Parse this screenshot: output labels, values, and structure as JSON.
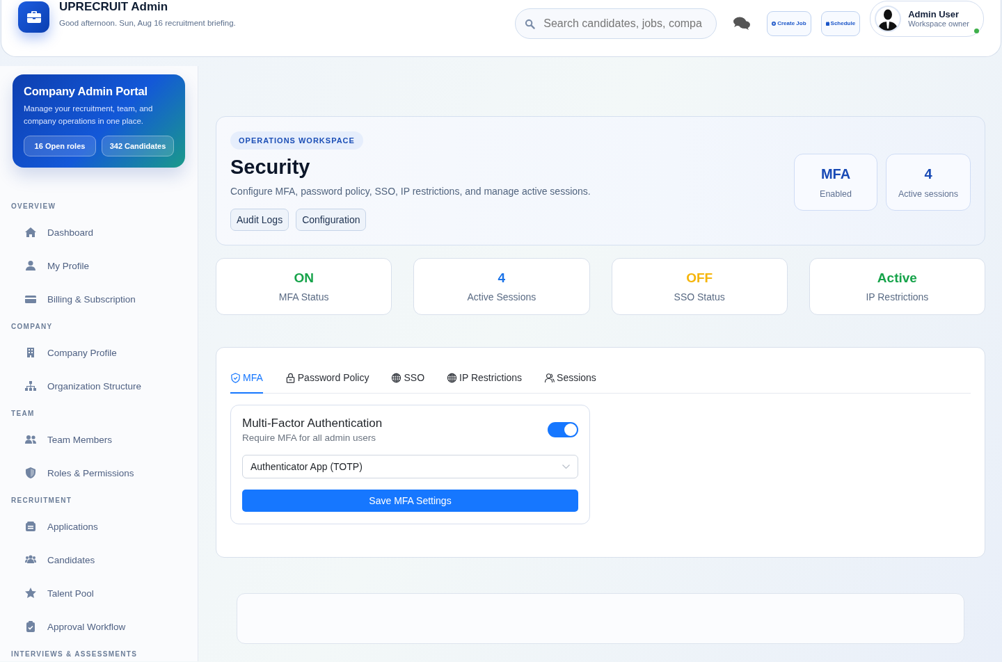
{
  "header": {
    "title": "UPRECRUIT Admin",
    "subtitle": "Good afternoon. Sun, Aug 16 recruitment briefing.",
    "search": {
      "placeholder": "Search candidates, jobs, compa"
    },
    "buttons": [
      "Create Job",
      "Schedule"
    ],
    "user": {
      "name": "Admin User",
      "role": "Workspace owner",
      "online": true
    }
  },
  "sidebar": {
    "promo": {
      "title": "Company Admin Portal",
      "text": "Manage your recruitment, team, and company operations in one place.",
      "chips": [
        "16 Open roles",
        "342 Candidates"
      ]
    },
    "sections": [
      {
        "title": "OVERVIEW",
        "items": [
          "Dashboard",
          "My Profile",
          "Billing & Subscription"
        ]
      },
      {
        "title": "COMPANY",
        "items": [
          "Company Profile",
          "Organization Structure"
        ]
      },
      {
        "title": "TEAM",
        "items": [
          "Team Members",
          "Roles & Permissions"
        ]
      },
      {
        "title": "RECRUITMENT",
        "items": [
          "Applications",
          "Candidates",
          "Talent Pool",
          "Approval Workflow"
        ]
      },
      {
        "title": "INTERVIEWS & ASSESSMENTS"
      }
    ]
  },
  "hero": {
    "eyebrow": "OPERATIONS WORKSPACE",
    "title": "Security",
    "description": "Configure MFA, password policy, SSO, IP restrictions, and manage active sessions.",
    "links": [
      "Audit Logs",
      "Configuration"
    ],
    "tiles": [
      {
        "value": "MFA",
        "label": "Enabled"
      },
      {
        "value": "4",
        "label": "Active sessions"
      }
    ]
  },
  "stats": [
    {
      "value": "ON",
      "label": "MFA Status",
      "color": "#16a34a"
    },
    {
      "value": "4",
      "label": "Active Sessions",
      "color": "#1a73e8"
    },
    {
      "value": "OFF",
      "label": "SSO Status",
      "color": "#f5b50a"
    },
    {
      "value": "Active",
      "label": "IP Restrictions",
      "color": "#16a34a"
    }
  ],
  "tabs": [
    {
      "label": "MFA",
      "selected": true
    },
    {
      "label": "Password Policy",
      "selected": false
    },
    {
      "label": "SSO",
      "selected": false
    },
    {
      "label": "IP Restrictions",
      "selected": false
    },
    {
      "label": "Sessions",
      "selected": false
    }
  ],
  "mfa": {
    "title": "Multi-Factor Authentication",
    "subtitle": "Require MFA for all admin users",
    "on": true,
    "method": "Authenticator App (TOTP)",
    "button": "Save MFA Settings"
  }
}
